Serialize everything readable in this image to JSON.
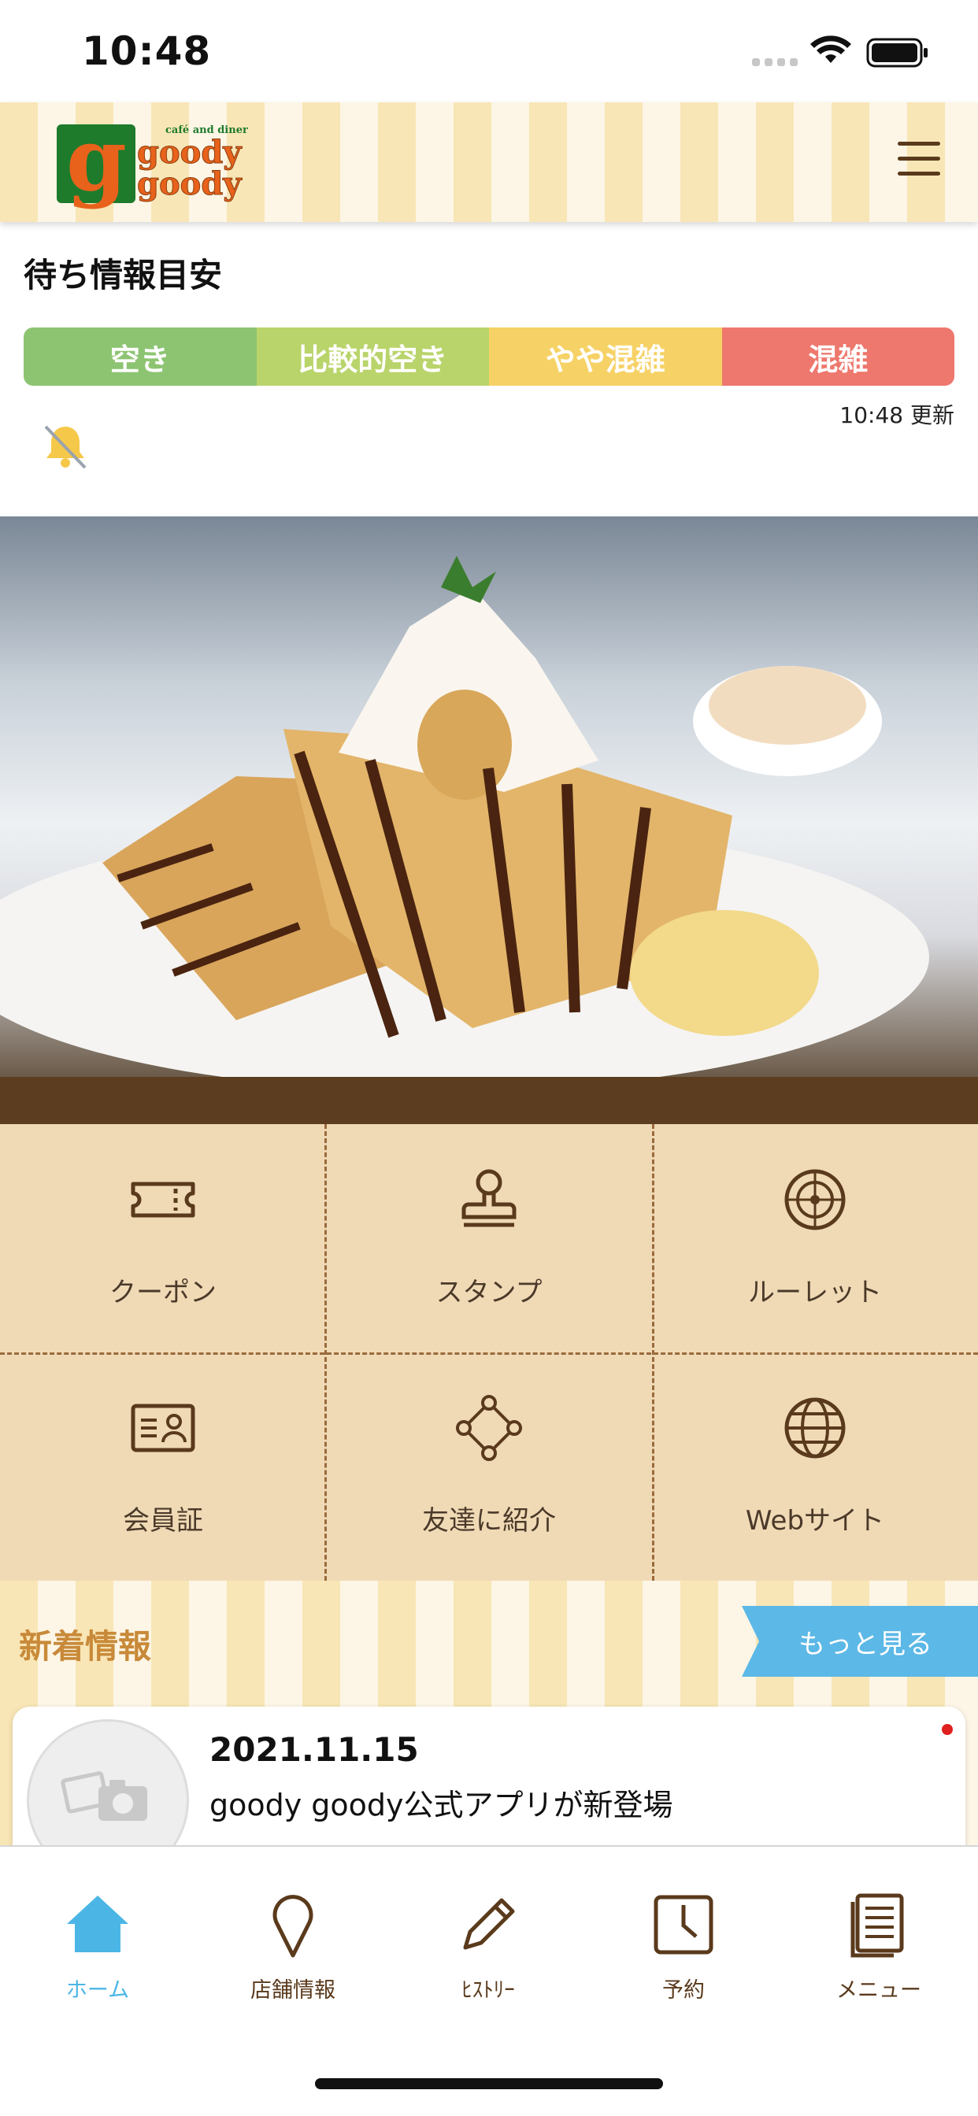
{
  "status_bar": {
    "time": "10:48"
  },
  "header": {
    "logo": {
      "sub": "café and diner",
      "word1": "goody",
      "word2": "goody",
      "badge_letter": "g"
    },
    "menu_icon": "hamburger-icon"
  },
  "wait_info": {
    "title": "待ち情報目安",
    "levels": [
      {
        "label": "空き",
        "color": "#8dc472"
      },
      {
        "label": "比較的空き",
        "color": "#b9d46a"
      },
      {
        "label": "やや混雑",
        "color": "#f6d266"
      },
      {
        "label": "混雑",
        "color": "#ee786d"
      }
    ],
    "updated": "10:48 更新"
  },
  "menu": {
    "items": [
      {
        "label": "クーポン",
        "icon": "ticket-icon"
      },
      {
        "label": "スタンプ",
        "icon": "stamp-icon"
      },
      {
        "label": "ルーレット",
        "icon": "roulette-icon"
      },
      {
        "label": "会員証",
        "icon": "member-card-icon"
      },
      {
        "label": "友達に紹介",
        "icon": "share-icon"
      },
      {
        "label": "Webサイト",
        "icon": "globe-icon"
      }
    ]
  },
  "news": {
    "title": "新着情報",
    "more_label": "もっと見る",
    "items": [
      {
        "date": "2021.11.15",
        "text": "goody goody公式アプリが新登場"
      }
    ]
  },
  "tabbar": {
    "tabs": [
      {
        "label": "ホーム",
        "icon": "home-icon",
        "active": true
      },
      {
        "label": "店舗情報",
        "icon": "location-pin-icon",
        "active": false
      },
      {
        "label": "ﾋｽﾄﾘｰ",
        "icon": "pencil-icon",
        "active": false
      },
      {
        "label": "予約",
        "icon": "clock-icon",
        "active": false
      },
      {
        "label": "メニュー",
        "icon": "menu-book-icon",
        "active": false
      }
    ]
  },
  "colors": {
    "accent": "#4bb6e6",
    "brown": "#5c3d1f",
    "grid_bg": "#f0dab6"
  }
}
